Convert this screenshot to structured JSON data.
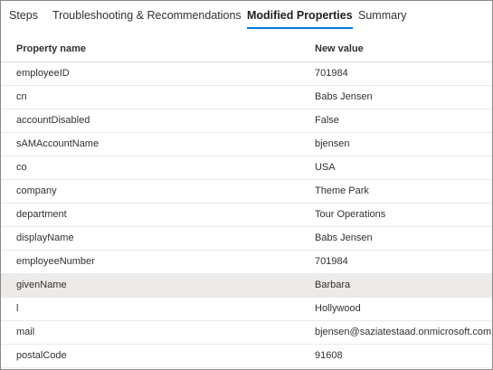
{
  "tabs": [
    {
      "label": "Steps"
    },
    {
      "label": "Troubleshooting & Recommendations"
    },
    {
      "label": "Modified Properties"
    },
    {
      "label": "Summary"
    }
  ],
  "active_tab": "Modified Properties",
  "table": {
    "columns": [
      "Property name",
      "New value"
    ],
    "rows": [
      [
        "employeeID",
        "701984"
      ],
      [
        "cn",
        "Babs Jensen"
      ],
      [
        "accountDisabled",
        "False"
      ],
      [
        "sAMAccountName",
        "bjensen"
      ],
      [
        "co",
        "USA"
      ],
      [
        "company",
        "Theme Park"
      ],
      [
        "department",
        "Tour Operations"
      ],
      [
        "displayName",
        "Babs Jensen"
      ],
      [
        "employeeNumber",
        "701984"
      ],
      [
        "givenName",
        "Barbara"
      ],
      [
        "l",
        "Hollywood"
      ],
      [
        "mail",
        "bjensen@saziatestaad.onmicrosoft.com"
      ],
      [
        "postalCode",
        "91608"
      ]
    ],
    "selected_row_index": 9
  },
  "colors": {
    "accent": "#0078d4",
    "selected_row": "#edebe9",
    "border": "#8a8886"
  }
}
